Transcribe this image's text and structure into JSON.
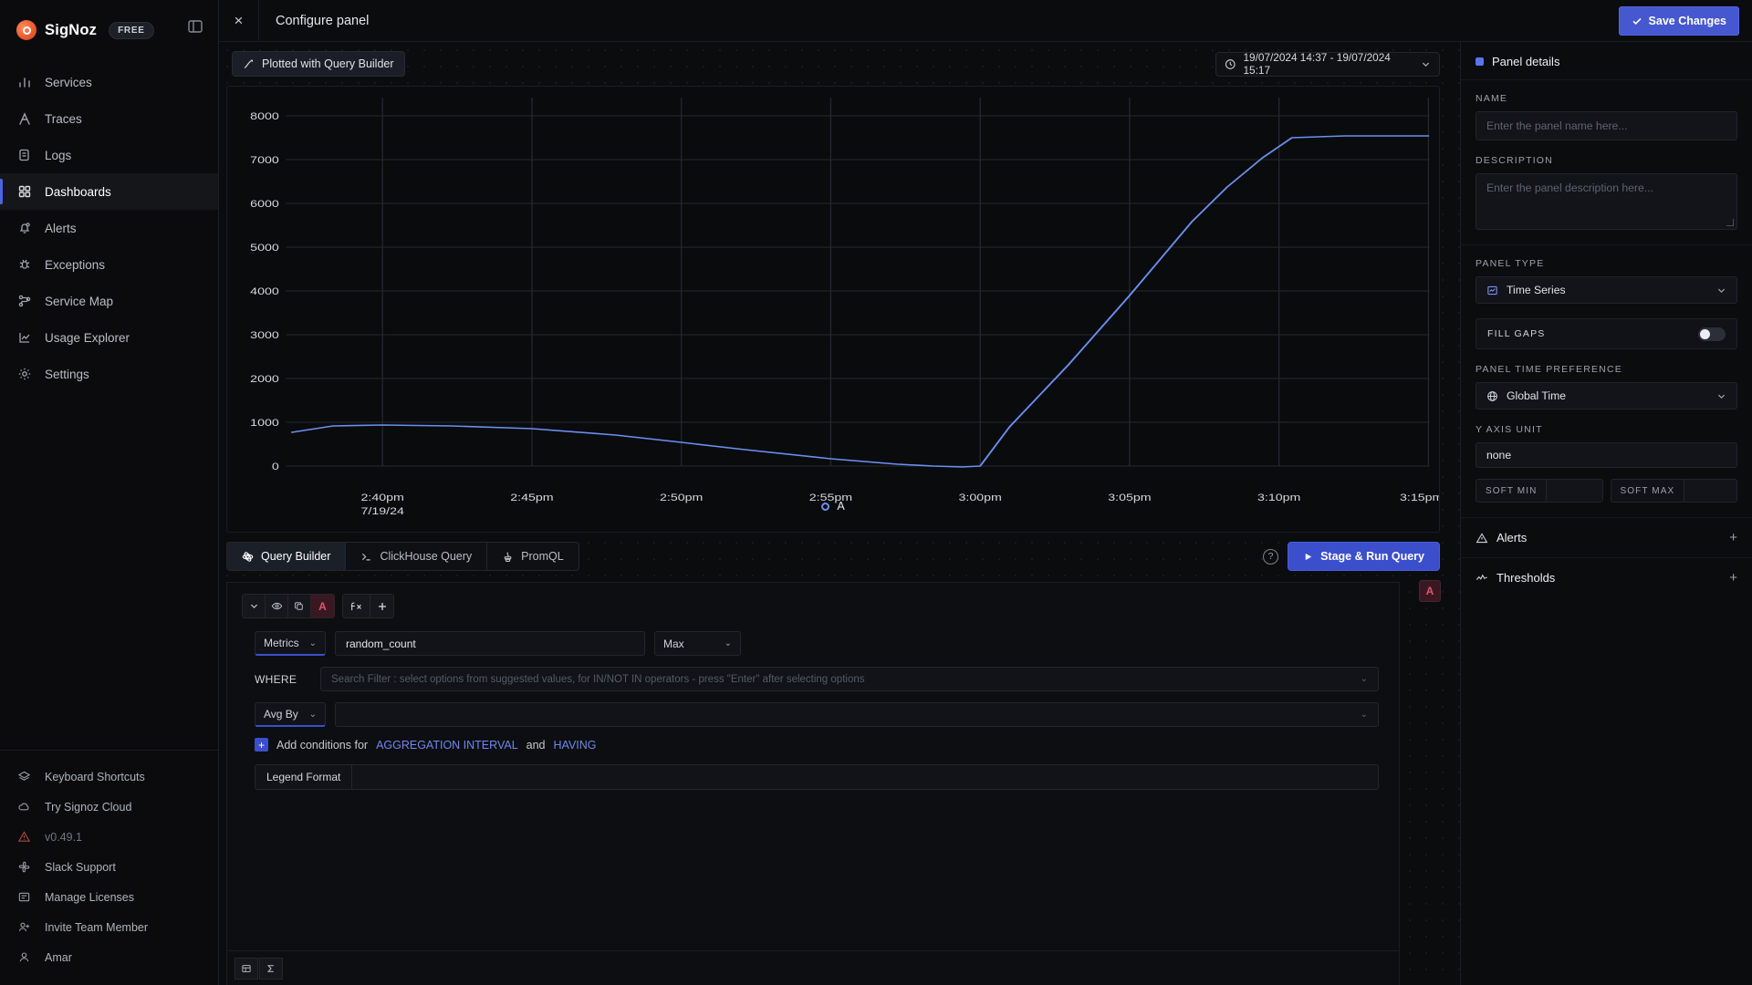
{
  "sidebar": {
    "brand": {
      "name": "SigNoz",
      "badge": "FREE"
    },
    "collapse_icon": "panel-collapse-icon",
    "items": [
      {
        "label": "Services",
        "icon": "bar-chart-icon",
        "active": false
      },
      {
        "label": "Traces",
        "icon": "traces-icon",
        "active": false
      },
      {
        "label": "Logs",
        "icon": "logs-icon",
        "active": false
      },
      {
        "label": "Dashboards",
        "icon": "grid-icon",
        "active": true
      },
      {
        "label": "Alerts",
        "icon": "bell-icon",
        "active": false
      },
      {
        "label": "Exceptions",
        "icon": "bug-icon",
        "active": false
      },
      {
        "label": "Service Map",
        "icon": "service-map-icon",
        "active": false
      },
      {
        "label": "Usage Explorer",
        "icon": "usage-icon",
        "active": false
      },
      {
        "label": "Settings",
        "icon": "gear-icon",
        "active": false
      }
    ],
    "bottom_items": [
      {
        "label": "Keyboard Shortcuts",
        "icon": "layers-icon"
      },
      {
        "label": "Try Signoz Cloud",
        "icon": "cloud-icon"
      },
      {
        "label": "v0.49.1",
        "icon": "warning-icon"
      },
      {
        "label": "Slack Support",
        "icon": "slack-icon"
      },
      {
        "label": "Manage Licenses",
        "icon": "license-icon"
      },
      {
        "label": "Invite Team Member",
        "icon": "user-plus-icon"
      },
      {
        "label": "Amar",
        "icon": "user-icon"
      }
    ]
  },
  "topbar": {
    "close_label": "×",
    "title": "Configure panel",
    "save_label": "Save Changes"
  },
  "chart_header": {
    "plotted_chip": "Plotted with  Query Builder",
    "time_range": "19/07/2024 14:37 - 19/07/2024 15:17"
  },
  "chart_data": {
    "type": "line",
    "title": "",
    "xlabel": "",
    "ylabel": "",
    "ylim": [
      0,
      8400
    ],
    "grid": true,
    "legend_position": "bottom",
    "legend": [
      "A"
    ],
    "series_color": "#6a8ff0",
    "y_ticks": [
      0,
      1000,
      2000,
      3000,
      4000,
      5000,
      6000,
      7000,
      8000
    ],
    "x_ticks": [
      "2:40pm",
      "2:45pm",
      "2:50pm",
      "2:55pm",
      "3:00pm",
      "3:05pm",
      "3:10pm",
      "3:15pm"
    ],
    "x_date_label": "7/19/24",
    "series": [
      {
        "name": "A",
        "x": [
          "2:37pm",
          "2:39pm",
          "2:40pm",
          "2:42pm",
          "2:45pm",
          "2:48pm",
          "2:50pm",
          "2:52pm",
          "2:55pm",
          "2:57pm",
          "2:58pm",
          "2:59pm",
          "3:00pm",
          "3:01pm",
          "3:03pm",
          "3:05pm",
          "3:07pm",
          "3:08pm",
          "3:09pm",
          "3:10pm",
          "3:12pm",
          "3:15pm",
          "3:17pm"
        ],
        "values": [
          760,
          880,
          890,
          890,
          880,
          830,
          770,
          690,
          560,
          480,
          450,
          440,
          450,
          900,
          2300,
          3900,
          5600,
          6400,
          7100,
          7500,
          7560,
          7560,
          7560
        ]
      }
    ]
  },
  "query_tabs": [
    {
      "label": "Query Builder",
      "icon": "atom-icon",
      "active": true
    },
    {
      "label": "ClickHouse Query",
      "icon": "terminal-icon",
      "active": false
    },
    {
      "label": "PromQL",
      "icon": "prometheus-icon",
      "active": false
    }
  ],
  "query_actions": {
    "help_icon": "question-mark-icon",
    "run_label": "Stage & Run Query",
    "run_icon": "play-icon"
  },
  "query_builder": {
    "toolbar": {
      "collapse_icon": "chevron-down-icon",
      "visibility_icon": "eye-icon",
      "copy_icon": "copy-icon",
      "letter": "A",
      "function_icon": "fx-icon",
      "add_icon": "plus-icon"
    },
    "data_source": "Metrics",
    "metric_name": "random_count",
    "aggregation": "Max",
    "where_label": "WHERE",
    "where_placeholder": "Search Filter : select options from suggested values, for IN/NOT IN operators - press \"Enter\" after selecting options",
    "group_by_label": "Avg By",
    "group_by_value": "",
    "add_conditions_prefix": "Add conditions for",
    "aggregation_interval_link": "AGGREGATION INTERVAL",
    "and_text": "and",
    "having_link": "HAVING",
    "legend_format_label": "Legend Format",
    "legend_format_value": "",
    "footer_icons": [
      "table-icon",
      "sigma-icon"
    ],
    "side_letter": "A"
  },
  "panel_details": {
    "title": "Panel details",
    "name_label": "NAME",
    "name_placeholder": "Enter the panel name here...",
    "description_label": "DESCRIPTION",
    "description_placeholder": "Enter the panel description here...",
    "panel_type_label": "PANEL TYPE",
    "panel_type_value": "Time Series",
    "fill_gaps_label": "FILL GAPS",
    "fill_gaps_on": false,
    "time_pref_label": "PANEL TIME PREFERENCE",
    "time_pref_value": "Global Time",
    "y_axis_label": "Y AXIS UNIT",
    "y_axis_value": "none",
    "soft_min_label": "SOFT MIN",
    "soft_min_value": "",
    "soft_max_label": "SOFT MAX",
    "soft_max_value": "",
    "alerts_label": "Alerts",
    "thresholds_label": "Thresholds",
    "add_icon": "plus-icon"
  },
  "colors": {
    "accent": "#4558d0",
    "series": "#6a8ff0",
    "letter_red": "#e0556f",
    "link": "#6c88f0"
  }
}
